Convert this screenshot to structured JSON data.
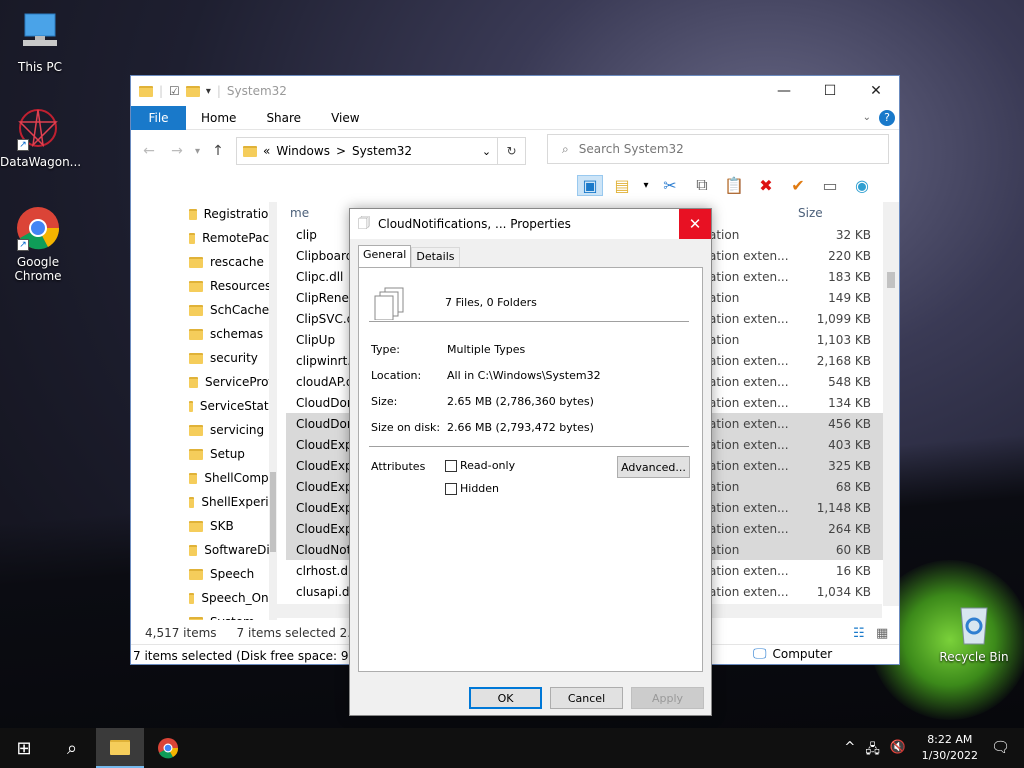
{
  "desktop": {
    "icons": [
      {
        "label": "This PC"
      },
      {
        "label": "DataWagon..."
      },
      {
        "label": "Google Chrome"
      },
      {
        "label": "Recycle Bin"
      }
    ]
  },
  "explorer": {
    "title": "System32",
    "tabs": [
      "File",
      "Home",
      "Share",
      "View"
    ],
    "breadcrumb": [
      "«",
      "Windows",
      ">",
      "System32"
    ],
    "search_placeholder": "Search System32",
    "tree": [
      "Registration",
      "RemotePack",
      "rescache",
      "Resources",
      "SchCache",
      "schemas",
      "security",
      "ServiceProfi",
      "ServiceState",
      "servicing",
      "Setup",
      "ShellCompo",
      "ShellExperie",
      "SKB",
      "SoftwareDis",
      "Speech",
      "Speech_One",
      "System"
    ],
    "columns": {
      "name": "me",
      "size": "Size"
    },
    "rows": [
      {
        "name": "clip",
        "type": "ation",
        "size": "32 KB",
        "sel": false
      },
      {
        "name": "ClipboardS",
        "type": "ation exten...",
        "size": "220 KB",
        "sel": false
      },
      {
        "name": "Clipc.dll",
        "type": "ation exten...",
        "size": "183 KB",
        "sel": false
      },
      {
        "name": "ClipRenew",
        "type": "ation",
        "size": "149 KB",
        "sel": false
      },
      {
        "name": "ClipSVC.dl",
        "type": "ation exten...",
        "size": "1,099 KB",
        "sel": false
      },
      {
        "name": "ClipUp",
        "type": "ation",
        "size": "1,103 KB",
        "sel": false
      },
      {
        "name": "clipwinrt.d",
        "type": "ation exten...",
        "size": "2,168 KB",
        "sel": false
      },
      {
        "name": "cloudAP.d",
        "type": "ation exten...",
        "size": "548 KB",
        "sel": false
      },
      {
        "name": "CloudDom",
        "type": "ation exten...",
        "size": "134 KB",
        "sel": false
      },
      {
        "name": "CloudDom",
        "type": "ation exten...",
        "size": "456 KB",
        "sel": true
      },
      {
        "name": "CloudExpe",
        "type": "ation exten...",
        "size": "403 KB",
        "sel": true
      },
      {
        "name": "CloudExpe",
        "type": "ation exten...",
        "size": "325 KB",
        "sel": true
      },
      {
        "name": "CloudExpe",
        "type": "ation",
        "size": "68 KB",
        "sel": true
      },
      {
        "name": "CloudExpe",
        "type": "ation exten...",
        "size": "1,148 KB",
        "sel": true
      },
      {
        "name": "CloudExpe",
        "type": "ation exten...",
        "size": "264 KB",
        "sel": true
      },
      {
        "name": "CloudNoti",
        "type": "ation",
        "size": "60 KB",
        "sel": true
      },
      {
        "name": "clrhost.dll",
        "type": "ation exten...",
        "size": "16 KB",
        "sel": false
      },
      {
        "name": "clusapi.dll",
        "type": "ation exten...",
        "size": "1,034 KB",
        "sel": false
      }
    ],
    "status": {
      "items": "4,517 items",
      "selected": "7 items selected  2.65 M",
      "details": "7 items selected (Disk free space: 95.5 GB)",
      "computer": "Computer"
    }
  },
  "dialog": {
    "title": "CloudNotifications, ... Properties",
    "tabs": [
      "General",
      "Details"
    ],
    "summary": "7 Files, 0 Folders",
    "type_label": "Type:",
    "type_value": "Multiple Types",
    "location_label": "Location:",
    "location_value": "All in C:\\Windows\\System32",
    "size_label": "Size:",
    "size_value": "2.65 MB (2,786,360 bytes)",
    "disk_label": "Size on disk:",
    "disk_value": "2.66 MB (2,793,472 bytes)",
    "attributes_label": "Attributes",
    "readonly": "Read-only",
    "hidden": "Hidden",
    "advanced": "Advanced...",
    "ok": "OK",
    "cancel": "Cancel",
    "apply": "Apply"
  },
  "taskbar": {
    "time": "8:22 AM",
    "date": "1/30/2022"
  }
}
